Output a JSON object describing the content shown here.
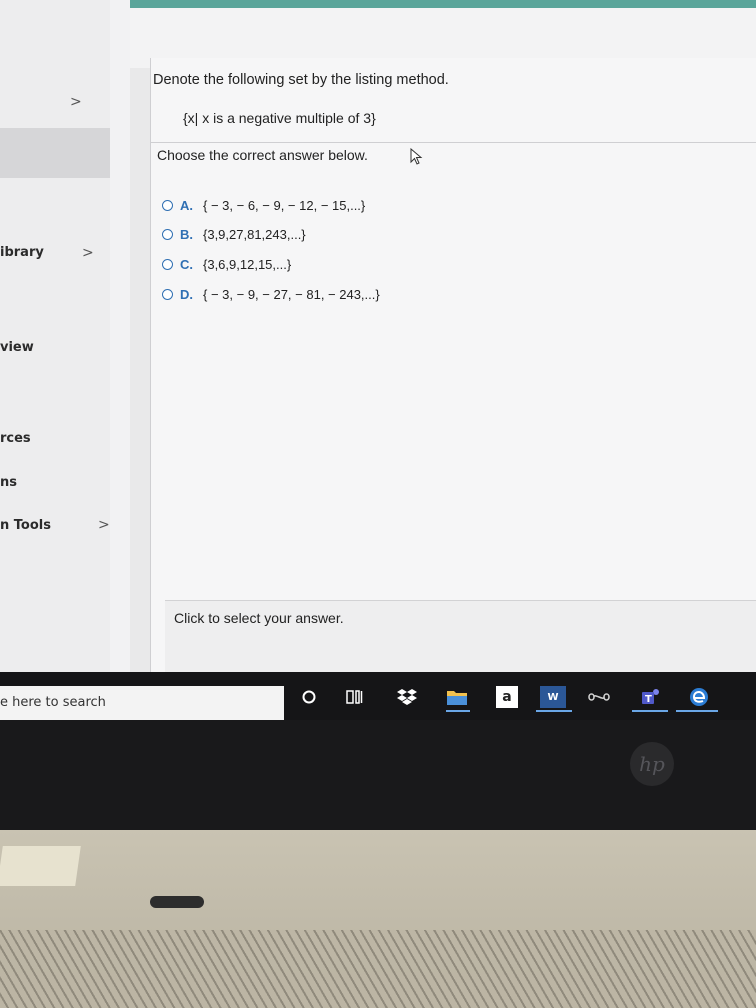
{
  "sidebar": {
    "items": [
      {
        "label": "ibrary",
        "chevron": ">"
      },
      {
        "label": "view",
        "chevron": ""
      },
      {
        "label": "rces",
        "chevron": ""
      },
      {
        "label": "ns",
        "chevron": ""
      },
      {
        "label": "n Tools",
        "chevron": ">"
      }
    ],
    "top_chevron": ">"
  },
  "question": {
    "prompt": "Denote the following set by the listing method.",
    "set_expression": "{x| x is a negative multiple of 3}",
    "instruction": "Choose the correct answer below.",
    "options": [
      {
        "letter": "A.",
        "text": "{ − 3, − 6, − 9, − 12, − 15,...}"
      },
      {
        "letter": "B.",
        "text": "{3,9,27,81,243,...}"
      },
      {
        "letter": "C.",
        "text": "{3,6,9,12,15,...}"
      },
      {
        "letter": "D.",
        "text": "{ − 3, − 9, − 27, − 81, − 243,...}"
      }
    ]
  },
  "footer": {
    "hint": "Click to select your answer."
  },
  "taskbar": {
    "search_text": "e here to search",
    "icons": [
      "cortana-icon",
      "task-view-icon",
      "dropbox-icon",
      "file-explorer-icon",
      "amazon-icon",
      "word-icon",
      "infinity-icon",
      "teams-icon",
      "edge-icon"
    ],
    "amazon_glyph": "a",
    "word_glyph": "W"
  },
  "laptop": {
    "logo_text": "hp"
  },
  "colors": {
    "accent_blue": "#2f6fb3",
    "top_teal": "#5aa59a"
  }
}
